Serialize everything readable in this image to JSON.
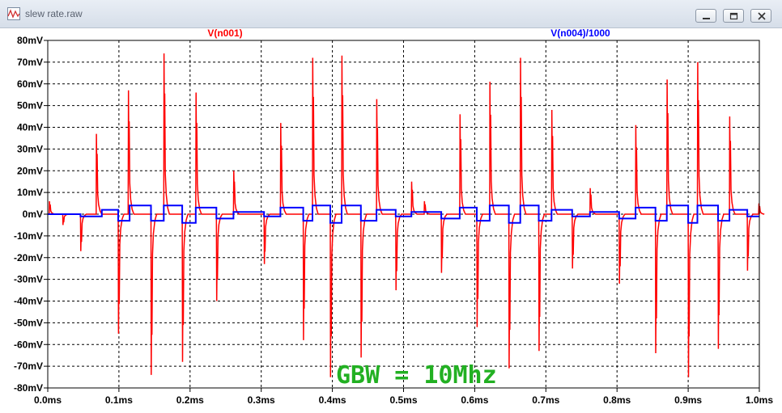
{
  "window": {
    "title": "slew rate.raw"
  },
  "chart_data": {
    "type": "line",
    "title": "",
    "xlabel": "",
    "ylabel": "",
    "xlim": [
      0,
      1.0
    ],
    "ylim": [
      -80,
      80
    ],
    "grid": true,
    "x_ticks": [
      "0.0ms",
      "0.1ms",
      "0.2ms",
      "0.3ms",
      "0.4ms",
      "0.5ms",
      "0.6ms",
      "0.7ms",
      "0.8ms",
      "0.9ms",
      "1.0ms"
    ],
    "y_ticks": [
      "80mV",
      "70mV",
      "60mV",
      "50mV",
      "40mV",
      "30mV",
      "20mV",
      "10mV",
      "0mV",
      "-10mV",
      "-20mV",
      "-30mV",
      "-40mV",
      "-50mV",
      "-60mV",
      "-70mV",
      "-80mV"
    ],
    "annotation": "GBW = 10Mhz",
    "series": [
      {
        "name": "V(n001)",
        "color": "#ff0000",
        "spikes": [
          {
            "x": 0.002,
            "amp": 6
          },
          {
            "x": 0.021,
            "amp": -5
          },
          {
            "x": 0.046,
            "amp": -17
          },
          {
            "x": 0.068,
            "amp": 37
          },
          {
            "x": 0.099,
            "amp": -55
          },
          {
            "x": 0.113,
            "amp": 57
          },
          {
            "x": 0.145,
            "amp": -74
          },
          {
            "x": 0.163,
            "amp": 74
          },
          {
            "x": 0.189,
            "amp": -68
          },
          {
            "x": 0.208,
            "amp": 56
          },
          {
            "x": 0.237,
            "amp": -40
          },
          {
            "x": 0.261,
            "amp": 20
          },
          {
            "x": 0.304,
            "amp": -23
          },
          {
            "x": 0.327,
            "amp": 42
          },
          {
            "x": 0.359,
            "amp": -58
          },
          {
            "x": 0.372,
            "amp": 72
          },
          {
            "x": 0.397,
            "amp": -75
          },
          {
            "x": 0.413,
            "amp": 73
          },
          {
            "x": 0.44,
            "amp": -66
          },
          {
            "x": 0.462,
            "amp": 53
          },
          {
            "x": 0.489,
            "amp": -35
          },
          {
            "x": 0.511,
            "amp": 15
          },
          {
            "x": 0.529,
            "amp": 6
          },
          {
            "x": 0.553,
            "amp": -27
          },
          {
            "x": 0.579,
            "amp": 46
          },
          {
            "x": 0.603,
            "amp": -52
          },
          {
            "x": 0.621,
            "amp": 61
          },
          {
            "x": 0.648,
            "amp": -71
          },
          {
            "x": 0.664,
            "amp": 72
          },
          {
            "x": 0.69,
            "amp": -63
          },
          {
            "x": 0.708,
            "amp": 48
          },
          {
            "x": 0.737,
            "amp": -25
          },
          {
            "x": 0.762,
            "amp": 12
          },
          {
            "x": 0.803,
            "amp": -32
          },
          {
            "x": 0.826,
            "amp": 41
          },
          {
            "x": 0.854,
            "amp": -64
          },
          {
            "x": 0.87,
            "amp": 62
          },
          {
            "x": 0.9,
            "amp": -75
          },
          {
            "x": 0.913,
            "amp": 70
          },
          {
            "x": 0.942,
            "amp": -62
          },
          {
            "x": 0.958,
            "amp": 45
          },
          {
            "x": 0.983,
            "amp": -26
          },
          {
            "x": 0.999,
            "amp": 5
          }
        ]
      },
      {
        "name": "V(n004)/1000",
        "color": "#0000ff",
        "steps": [
          {
            "x": 0.0,
            "y": 0
          },
          {
            "x": 0.024,
            "y": 0
          },
          {
            "x": 0.046,
            "y": -1
          },
          {
            "x": 0.068,
            "y": -1
          },
          {
            "x": 0.076,
            "y": 2
          },
          {
            "x": 0.098,
            "y": 2
          },
          {
            "x": 0.099,
            "y": -3
          },
          {
            "x": 0.113,
            "y": -3
          },
          {
            "x": 0.115,
            "y": 4
          },
          {
            "x": 0.135,
            "y": 4
          },
          {
            "x": 0.145,
            "y": -3
          },
          {
            "x": 0.163,
            "y": -3
          },
          {
            "x": 0.163,
            "y": 4
          },
          {
            "x": 0.183,
            "y": 4
          },
          {
            "x": 0.189,
            "y": -4
          },
          {
            "x": 0.208,
            "y": -4
          },
          {
            "x": 0.208,
            "y": 3
          },
          {
            "x": 0.237,
            "y": 3
          },
          {
            "x": 0.237,
            "y": -2
          },
          {
            "x": 0.261,
            "y": -2
          },
          {
            "x": 0.261,
            "y": 1
          },
          {
            "x": 0.304,
            "y": 1
          },
          {
            "x": 0.304,
            "y": -1
          },
          {
            "x": 0.327,
            "y": -1
          },
          {
            "x": 0.327,
            "y": 3
          },
          {
            "x": 0.359,
            "y": 3
          },
          {
            "x": 0.359,
            "y": -3
          },
          {
            "x": 0.372,
            "y": -3
          },
          {
            "x": 0.372,
            "y": 4
          },
          {
            "x": 0.397,
            "y": 4
          },
          {
            "x": 0.397,
            "y": -4
          },
          {
            "x": 0.413,
            "y": -4
          },
          {
            "x": 0.413,
            "y": 4
          },
          {
            "x": 0.44,
            "y": 4
          },
          {
            "x": 0.44,
            "y": -3
          },
          {
            "x": 0.462,
            "y": -3
          },
          {
            "x": 0.462,
            "y": 2
          },
          {
            "x": 0.489,
            "y": 2
          },
          {
            "x": 0.489,
            "y": -1
          },
          {
            "x": 0.511,
            "y": -1
          },
          {
            "x": 0.511,
            "y": 1
          },
          {
            "x": 0.553,
            "y": 1
          },
          {
            "x": 0.553,
            "y": -2
          },
          {
            "x": 0.579,
            "y": -2
          },
          {
            "x": 0.579,
            "y": 3
          },
          {
            "x": 0.603,
            "y": 3
          },
          {
            "x": 0.603,
            "y": -3
          },
          {
            "x": 0.621,
            "y": -3
          },
          {
            "x": 0.621,
            "y": 4
          },
          {
            "x": 0.648,
            "y": 4
          },
          {
            "x": 0.648,
            "y": -4
          },
          {
            "x": 0.664,
            "y": -4
          },
          {
            "x": 0.664,
            "y": 4
          },
          {
            "x": 0.69,
            "y": 4
          },
          {
            "x": 0.69,
            "y": -3
          },
          {
            "x": 0.708,
            "y": -3
          },
          {
            "x": 0.708,
            "y": 2
          },
          {
            "x": 0.737,
            "y": 2
          },
          {
            "x": 0.737,
            "y": -1
          },
          {
            "x": 0.762,
            "y": -1
          },
          {
            "x": 0.762,
            "y": 1
          },
          {
            "x": 0.803,
            "y": 1
          },
          {
            "x": 0.803,
            "y": -2
          },
          {
            "x": 0.826,
            "y": -2
          },
          {
            "x": 0.826,
            "y": 3
          },
          {
            "x": 0.854,
            "y": 3
          },
          {
            "x": 0.854,
            "y": -3
          },
          {
            "x": 0.87,
            "y": -3
          },
          {
            "x": 0.87,
            "y": 4
          },
          {
            "x": 0.9,
            "y": 4
          },
          {
            "x": 0.9,
            "y": -4
          },
          {
            "x": 0.913,
            "y": -4
          },
          {
            "x": 0.913,
            "y": 4
          },
          {
            "x": 0.942,
            "y": 4
          },
          {
            "x": 0.942,
            "y": -3
          },
          {
            "x": 0.958,
            "y": -3
          },
          {
            "x": 0.958,
            "y": 2
          },
          {
            "x": 0.983,
            "y": 2
          },
          {
            "x": 0.983,
            "y": -1
          },
          {
            "x": 1.0,
            "y": -1
          }
        ]
      }
    ]
  }
}
